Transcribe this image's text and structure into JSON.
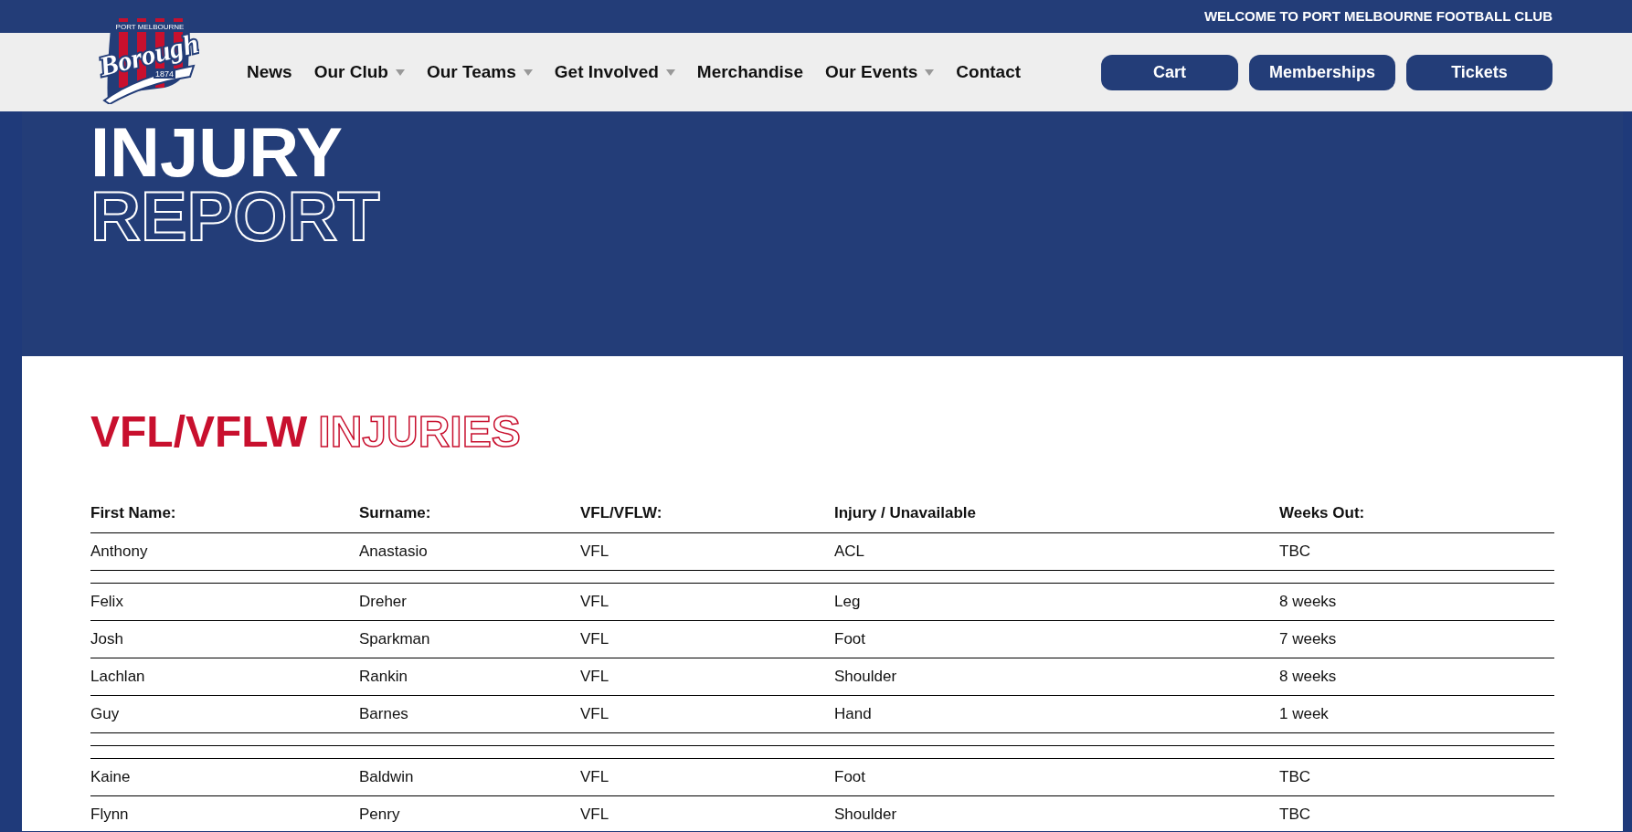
{
  "top_bar": {
    "text": "WELCOME TO PORT MELBOURNE FOOTBALL CLUB"
  },
  "logo": {
    "top_text": "PORT MELBOURNE",
    "name": "Borough",
    "year": "1874"
  },
  "nav": [
    {
      "label": "News",
      "dropdown": false
    },
    {
      "label": "Our Club",
      "dropdown": true
    },
    {
      "label": "Our Teams",
      "dropdown": true
    },
    {
      "label": "Get Involved",
      "dropdown": true
    },
    {
      "label": "Merchandise",
      "dropdown": false
    },
    {
      "label": "Our Events",
      "dropdown": true
    },
    {
      "label": "Contact",
      "dropdown": false
    }
  ],
  "buttons": [
    "Cart",
    "Memberships",
    "Tickets"
  ],
  "hero": {
    "title_solid": "INJURY",
    "title_outline": "REPORT"
  },
  "section": {
    "title_solid": "VFL/VFLW",
    "title_outline": "INJURIES"
  },
  "table": {
    "columns": [
      "First Name:",
      "Surname:",
      "VFL/VFLW:",
      "Injury / Unavailable",
      "Weeks Out:"
    ],
    "rows": [
      {
        "kind": "player",
        "cells": [
          "Anthony",
          "Anastasio",
          "VFL",
          "ACL",
          "TBC"
        ]
      },
      {
        "kind": "blank"
      },
      {
        "kind": "player",
        "cells": [
          "Felix",
          "Dreher",
          "VFL",
          "Leg",
          "8 weeks"
        ]
      },
      {
        "kind": "player",
        "cells": [
          "Josh",
          "Sparkman",
          "VFL",
          "Foot",
          "7 weeks"
        ]
      },
      {
        "kind": "player",
        "cells": [
          "Lachlan",
          "Rankin",
          "VFL",
          "Shoulder",
          "8 weeks"
        ]
      },
      {
        "kind": "player",
        "cells": [
          "Guy",
          "Barnes",
          "VFL",
          "Hand",
          "1 week"
        ]
      },
      {
        "kind": "blank"
      },
      {
        "kind": "blank"
      },
      {
        "kind": "player",
        "cells": [
          "Kaine",
          "Baldwin",
          "VFL",
          "Foot",
          "TBC"
        ]
      },
      {
        "kind": "player",
        "cells": [
          "Flynn",
          "Penry",
          "VFL",
          "Shoulder",
          "TBC"
        ]
      }
    ]
  }
}
